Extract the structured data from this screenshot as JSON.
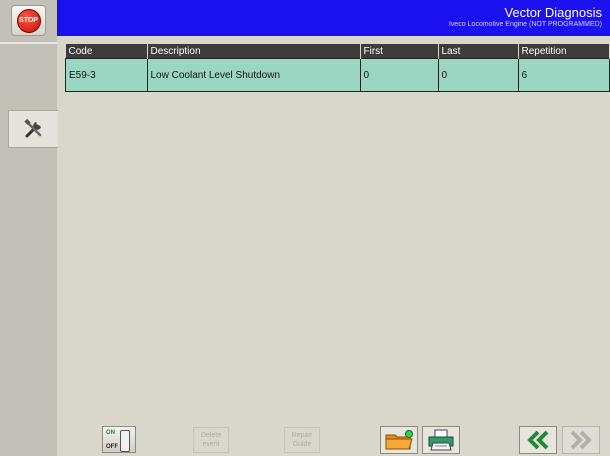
{
  "header": {
    "title": "Vector Diagnosis",
    "subtitle": "Iveco Locomotive Engine (NOT PROGRAMMED)"
  },
  "sidebar": {
    "stop_label": "STOP",
    "tools_icon": "tools-icon"
  },
  "table": {
    "columns": [
      "Code",
      "Description",
      "First",
      "Last",
      "Repetition"
    ],
    "rows": [
      {
        "code": "E59-3",
        "description": "Low Coolant Level Shutdown",
        "first": "0",
        "last": "0",
        "repetition": "6"
      }
    ]
  },
  "toolbar": {
    "on_label": "ON",
    "off_label": "OFF",
    "delete_event_line1": "Delete",
    "delete_event_line2": "event",
    "repair_guide_line1": "Repair",
    "repair_guide_line2": "Guide",
    "icons": [
      "on-off-switch-icon",
      "folder-icon",
      "printer-icon",
      "double-chevron-left-icon",
      "double-chevron-right-icon"
    ]
  },
  "colors": {
    "header_bg": "#1a10f0",
    "row_bg": "#9bd6c3",
    "table_header_bg": "#3c3c3c",
    "accent_green": "#1f8a3a"
  }
}
